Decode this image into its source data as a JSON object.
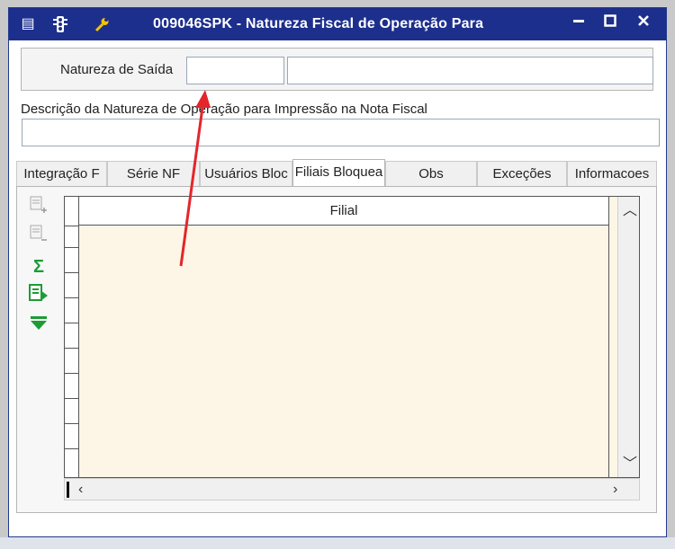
{
  "window": {
    "title": "009046SPK - Natureza Fiscal de Operação Para",
    "titlebar_color": "#1d2f8c",
    "left_icons": [
      "document-arrow-icon",
      "traffic-light-icon",
      "wrench-icon"
    ],
    "controls": [
      "minimize-icon",
      "maximize-icon",
      "close-icon"
    ]
  },
  "form": {
    "natureza_label": "Natureza de Saída",
    "natureza_code_value": "",
    "natureza_name_value": "",
    "descricao_label": "Descrição da Natureza de Operação para Impressão na Nota Fiscal",
    "descricao_value": ""
  },
  "tabs": [
    {
      "label": "Integração F",
      "active": false
    },
    {
      "label": "Série NF",
      "active": false
    },
    {
      "label": "Usuários Bloc",
      "active": false
    },
    {
      "label": "Filiais Bloquea",
      "active": true
    },
    {
      "label": "Obs",
      "active": false
    },
    {
      "label": "Exceções",
      "active": false
    },
    {
      "label": "Informacoes",
      "active": false
    }
  ],
  "grid": {
    "columns": [
      "Filial"
    ],
    "rows": [],
    "row_color": "#fdf6e6"
  },
  "toolbar_icons": [
    "add-row-icon",
    "remove-row-icon",
    "sum-icon",
    "export-icon",
    "collapse-icon"
  ],
  "annotation": {
    "color": "#e3262b",
    "shape": "arrow"
  }
}
